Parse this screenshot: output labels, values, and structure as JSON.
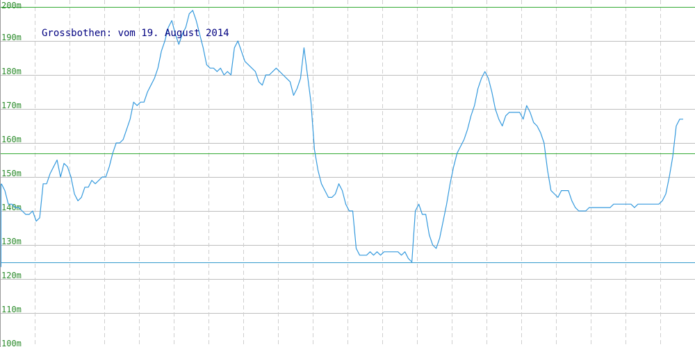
{
  "chart_data": {
    "type": "line",
    "title": "Grossbothen: vom 19. August 2014",
    "xlabel": "",
    "ylabel": "",
    "ylim": [
      100,
      200
    ],
    "yticks": [
      200,
      190,
      180,
      170,
      160,
      150,
      140,
      130,
      120,
      110,
      100
    ],
    "ytick_labels": [
      "200m",
      "190m",
      "180m",
      "170m",
      "160m",
      "150m",
      "140m",
      "130m",
      "120m",
      "110m",
      "100m"
    ],
    "xlim": [
      0,
      199
    ],
    "grid": true,
    "reference_lines": [
      {
        "name": "max",
        "value": 200,
        "color": "#33aa33"
      },
      {
        "name": "mean",
        "value": 157,
        "color": "#33aa33"
      },
      {
        "name": "min",
        "value": 125,
        "color": "#3399cc"
      }
    ],
    "series": [
      {
        "color": "#3399dd",
        "values": [
          148,
          146,
          142,
          142,
          141,
          141,
          140,
          139,
          139,
          140,
          137,
          138,
          148,
          148,
          151,
          153,
          155,
          150,
          154,
          153,
          150,
          145,
          143,
          144,
          147,
          147,
          149,
          148,
          149,
          150,
          150,
          153,
          157,
          160,
          160,
          161,
          164,
          167,
          172,
          171,
          172,
          172,
          175,
          177,
          179,
          182,
          187,
          190,
          194,
          196,
          192,
          189,
          192,
          194,
          198,
          199,
          196,
          192,
          188,
          183,
          182,
          182,
          181,
          182,
          180,
          181,
          180,
          188,
          190,
          187,
          184,
          183,
          182,
          181,
          178,
          177,
          180,
          180,
          181,
          182,
          181,
          180,
          179,
          178,
          174,
          176,
          179,
          188,
          180,
          172,
          158,
          152,
          148,
          146,
          144,
          144,
          145,
          148,
          146,
          142,
          140,
          140,
          129,
          127,
          127,
          127,
          128,
          127,
          128,
          127,
          128,
          128,
          128,
          128,
          128,
          127,
          128,
          126,
          125,
          140,
          142,
          139,
          139,
          133,
          130,
          129,
          132,
          137,
          142,
          148,
          153,
          157,
          159,
          161,
          164,
          168,
          171,
          176,
          179,
          181,
          179,
          175,
          170,
          167,
          165,
          168,
          169,
          169,
          169,
          169,
          167,
          171,
          169,
          166,
          165,
          163,
          160,
          152,
          146,
          145,
          144,
          146,
          146,
          146,
          143,
          141,
          140,
          140,
          140,
          141,
          141,
          141,
          141,
          141,
          141,
          141,
          142,
          142,
          142,
          142,
          142,
          142,
          141,
          142,
          142,
          142,
          142,
          142,
          142,
          142,
          143,
          145,
          150,
          156,
          165,
          167,
          167
        ]
      }
    ]
  }
}
